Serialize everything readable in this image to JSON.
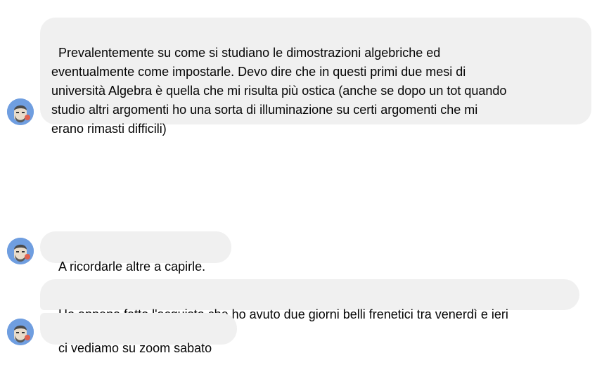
{
  "messages": [
    {
      "text": "Prevalentemente su come si studiano le dimostrazioni algebriche ed\neventualmente come impostarle. Devo dire che in questi primi due mesi di\nuniversità Algebra è quella che mi risulta più ostica (anche se dopo un tot quando\nstudio altri argomenti ho una sorta di illuminazione su certi argomenti che mi\nerano rimasti difficili)"
    },
    {
      "text": "A ricordarle altre a capirle."
    },
    {
      "text": "Ho appena fatto l'acquisto che ho avuto due giorni belli frenetici tra venerdì e ieri"
    },
    {
      "text": "ci vediamo su zoom sabato"
    }
  ],
  "colors": {
    "bubble_bg": "#f0f0f0",
    "avatar_bg": "#6f9ee0",
    "text": "#050505"
  },
  "icons": {
    "avatar": "bearded-man-avatar-icon"
  }
}
